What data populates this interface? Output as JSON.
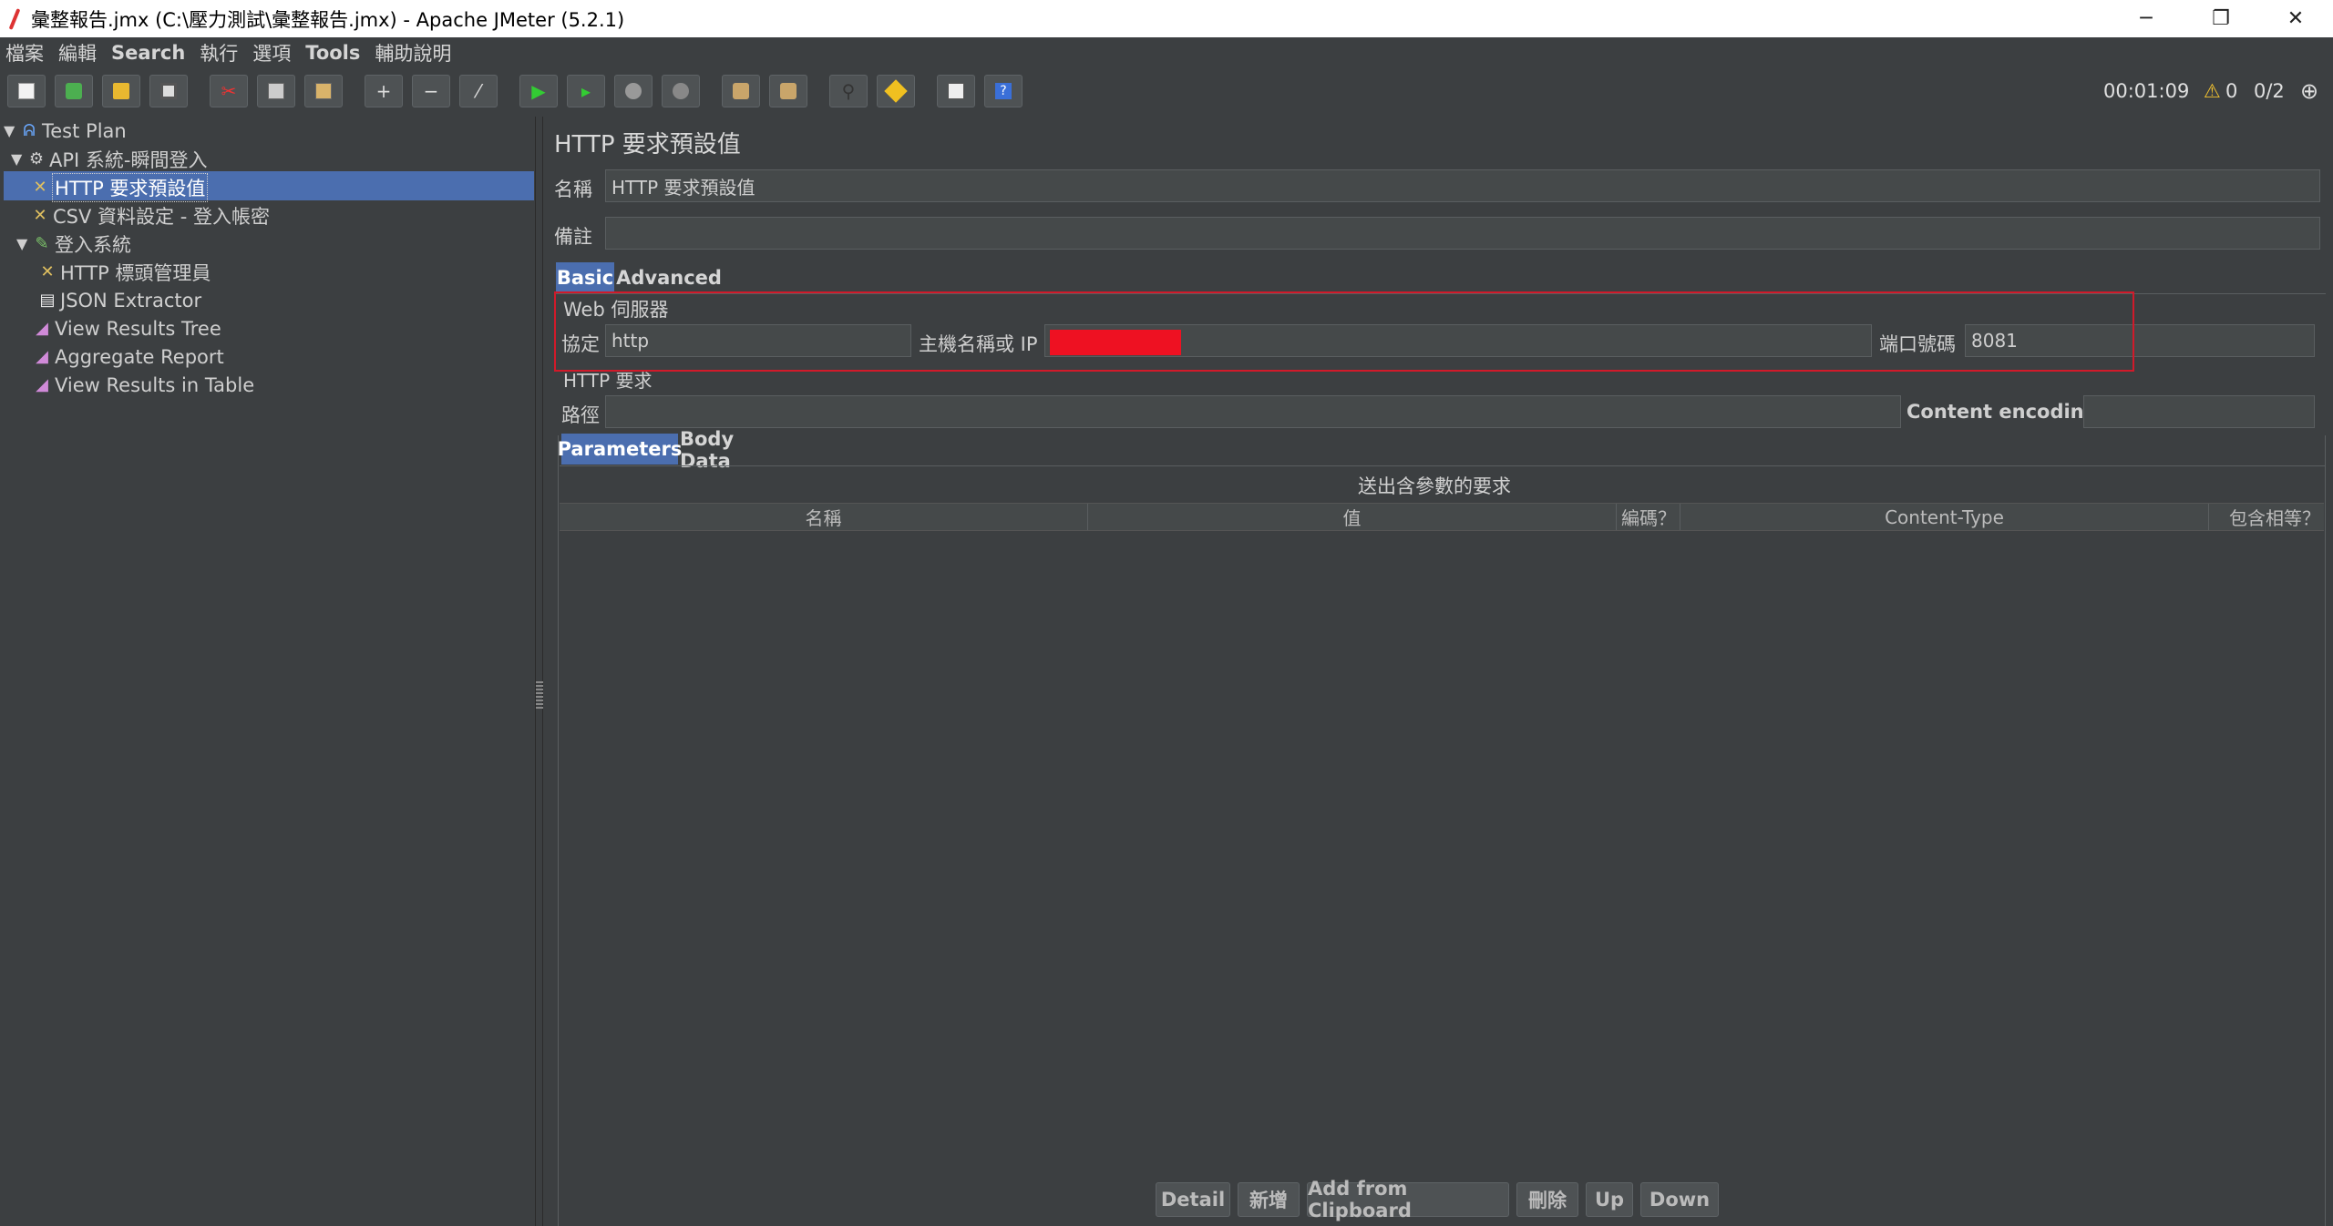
{
  "window": {
    "title": "彙整報告.jmx (C:\\壓力測試\\彙整報告.jmx) - Apache JMeter (5.2.1)",
    "controls": {
      "minimize": "─",
      "restore": "❐",
      "close": "✕"
    }
  },
  "menu": [
    "檔案",
    "編輯",
    "Search",
    "執行",
    "選項",
    "Tools",
    "輔助說明"
  ],
  "toolbar": {
    "icons": [
      "new-icon",
      "templates-icon",
      "open-icon",
      "save-icon",
      "cut-icon",
      "copy-icon",
      "paste-icon",
      "expand-icon",
      "collapse-icon",
      "toggle-icon",
      "start-icon",
      "start-no-pause-icon",
      "stop-icon",
      "shutdown-icon",
      "clear-icon",
      "clear-all-icon",
      "search-icon",
      "reset-search-icon",
      "function-helper-icon",
      "help-icon"
    ],
    "timer": "00:01:09",
    "warnings": "0",
    "threads": "0/2"
  },
  "tree": [
    {
      "label": "Test Plan",
      "level": 0,
      "expanded": true,
      "icon": "test-plan-icon"
    },
    {
      "label": "API 系統-瞬間登入",
      "level": 1,
      "expanded": true,
      "icon": "thread-group-icon"
    },
    {
      "label": "HTTP 要求預設值",
      "level": 2,
      "icon": "config-element-icon",
      "selected": true
    },
    {
      "label": "CSV 資料設定 - 登入帳密",
      "level": 2,
      "icon": "config-element-icon"
    },
    {
      "label": "登入系統",
      "level": 2,
      "expanded": true,
      "icon": "sampler-icon"
    },
    {
      "label": "HTTP 標頭管理員",
      "level": 3,
      "icon": "config-element-icon"
    },
    {
      "label": "JSON Extractor",
      "level": 3,
      "icon": "extractor-icon"
    },
    {
      "label": "View Results Tree",
      "level": 3,
      "icon": "listener-icon"
    },
    {
      "label": "Aggregate Report",
      "level": 3,
      "icon": "listener-icon"
    },
    {
      "label": "View Results in Table",
      "level": 3,
      "icon": "listener-icon"
    }
  ],
  "panel": {
    "title": "HTTP 要求預設值",
    "name_label": "名稱",
    "name_value": "HTTP 要求預設值",
    "comment_label": "備註",
    "comment_value": "",
    "tabs": [
      "Basic",
      "Advanced"
    ],
    "web_server": {
      "section": "Web 伺服器",
      "protocol_label": "協定",
      "protocol_value": "http",
      "host_label": "主機名稱或 IP",
      "host_value": "",
      "port_label": "端口號碼",
      "port_value": "8081"
    },
    "http_request": {
      "section": "HTTP 要求",
      "path_label": "路徑",
      "path_value": "",
      "encoding_label": "Content encoding:",
      "encoding_value": ""
    },
    "subtabs": [
      "Parameters",
      "Body Data"
    ],
    "params_caption": "送出含參數的要求",
    "columns": [
      "名稱",
      "值",
      "編碼？",
      "Content-Type",
      "包含相等？"
    ],
    "buttons": [
      "Detail",
      "新增",
      "Add from Clipboard",
      "刪除",
      "Up",
      "Down"
    ]
  },
  "colors": {
    "background": "#3c3f41",
    "selection": "#4b6eaf",
    "highlight_box": "#d11a2a",
    "redaction": "#ee1122"
  }
}
